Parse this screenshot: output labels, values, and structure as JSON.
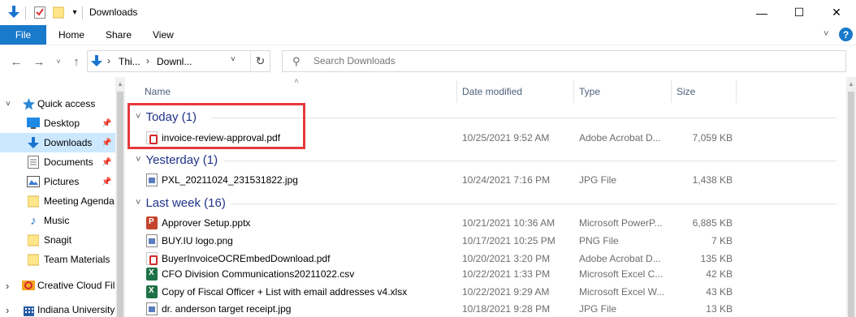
{
  "window": {
    "title": "Downloads",
    "minimize_glyph": "—",
    "maximize_glyph": "☐",
    "close_glyph": "✕"
  },
  "ribbon": {
    "tabs": [
      "File",
      "Home",
      "Share",
      "View"
    ],
    "help_label": "?"
  },
  "address": {
    "segments": [
      "Thi...",
      "Downl..."
    ],
    "search_placeholder": "Search Downloads"
  },
  "nav": {
    "items": [
      {
        "label": "Quick access",
        "icon": "star-icon",
        "expander": "˅",
        "pinned": false
      },
      {
        "label": "Desktop",
        "icon": "desktop-icon",
        "pinned": true
      },
      {
        "label": "Downloads",
        "icon": "download-icon",
        "pinned": true,
        "selected": true
      },
      {
        "label": "Documents",
        "icon": "documents-icon",
        "pinned": true
      },
      {
        "label": "Pictures",
        "icon": "pictures-icon",
        "pinned": true
      },
      {
        "label": "Meeting Agenda",
        "icon": "folder-icon",
        "pinned": false
      },
      {
        "label": "Music",
        "icon": "music-icon",
        "pinned": false
      },
      {
        "label": "Snagit",
        "icon": "folder-icon",
        "pinned": false
      },
      {
        "label": "Team Materials",
        "icon": "folder-icon",
        "pinned": false
      },
      {
        "label": "Creative Cloud Fil",
        "icon": "creative-cloud-icon",
        "expander": "›",
        "pinned": false
      },
      {
        "label": "Indiana University",
        "icon": "building-icon",
        "expander": "›",
        "pinned": false
      }
    ]
  },
  "columns": {
    "name": "Name",
    "date": "Date modified",
    "type": "Type",
    "size": "Size"
  },
  "groups": [
    {
      "label": "Today (1)"
    },
    {
      "label": "Yesterday (1)"
    },
    {
      "label": "Last week (16)"
    }
  ],
  "files": [
    {
      "name": "invoice-review-approval.pdf",
      "date": "10/25/2021 9:52 AM",
      "type": "Adobe Acrobat D...",
      "size": "7,059 KB",
      "icon": "pdf-icon"
    },
    {
      "name": "PXL_20211024_231531822.jpg",
      "date": "10/24/2021 7:16 PM",
      "type": "JPG File",
      "size": "1,438 KB",
      "icon": "image-icon"
    },
    {
      "name": "Approver Setup.pptx",
      "date": "10/21/2021 10:36 AM",
      "type": "Microsoft PowerP...",
      "size": "6,885 KB",
      "icon": "powerpoint-icon"
    },
    {
      "name": "BUY.IU logo.png",
      "date": "10/17/2021 10:25 PM",
      "type": "PNG File",
      "size": "7 KB",
      "icon": "image-icon"
    },
    {
      "name": "BuyerInvoiceOCREmbedDownload.pdf",
      "date": "10/20/2021 3:20 PM",
      "type": "Adobe Acrobat D...",
      "size": "135 KB",
      "icon": "pdf-icon"
    },
    {
      "name": "CFO Division Communications20211022.csv",
      "date": "10/22/2021 1:33 PM",
      "type": "Microsoft Excel C...",
      "size": "42 KB",
      "icon": "excel-icon"
    },
    {
      "name": "Copy of Fiscal Officer + List with email addresses v4.xlsx",
      "date": "10/22/2021 9:29 AM",
      "type": "Microsoft Excel W...",
      "size": "43 KB",
      "icon": "excel-icon"
    },
    {
      "name": "dr. anderson target receipt.jpg",
      "date": "10/18/2021 9:28 PM",
      "type": "JPG File",
      "size": "13 KB",
      "icon": "image-icon"
    }
  ]
}
